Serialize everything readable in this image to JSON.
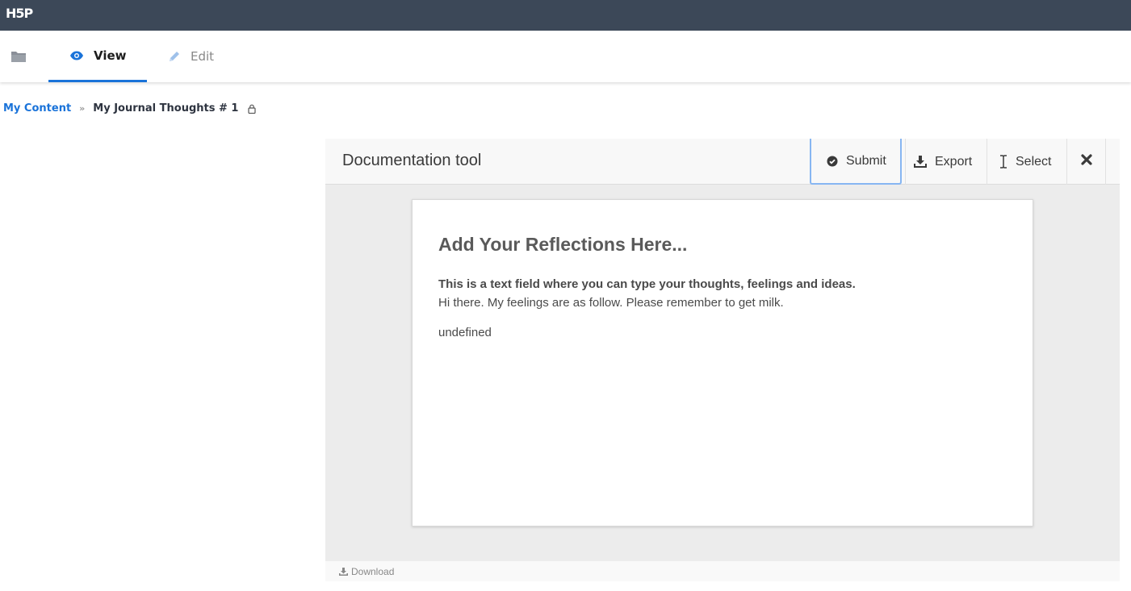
{
  "topbar": {
    "logo": "H5P"
  },
  "tabs": {
    "view": "View",
    "edit": "Edit"
  },
  "breadcrumb": {
    "root": "My Content",
    "separator": "»",
    "current": "My Journal Thoughts # 1"
  },
  "tool": {
    "title": "Documentation tool",
    "buttons": {
      "submit": "Submit",
      "export": "Export",
      "select": "Select"
    }
  },
  "page": {
    "heading": "Add Your Reflections Here...",
    "instructions": "This is a text field where you can type your thoughts, feelings and ideas.",
    "answer": "Hi there. My feelings are as follow. Please remember to get milk.",
    "extra": "undefined"
  },
  "footer": {
    "download": "Download"
  },
  "colors": {
    "topbar": "#3c4858",
    "accent": "#1a73d9",
    "submit_focus": "#87b6f2"
  }
}
